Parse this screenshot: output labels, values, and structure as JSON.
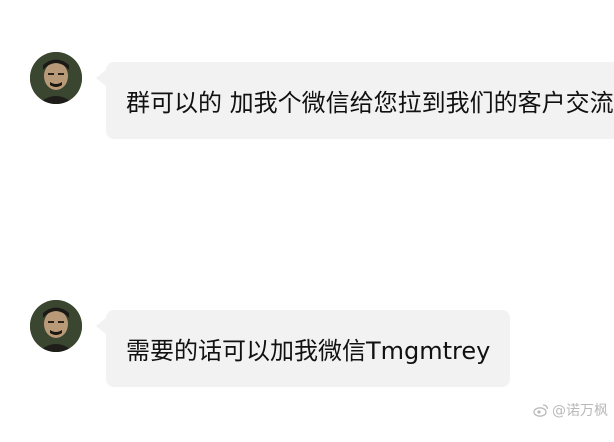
{
  "messages": [
    {
      "text": "群可以的 加我个微信给您拉到我们的客户交流群"
    },
    {
      "text": "需要的话可以加我微信Tmgmtrey"
    }
  ],
  "watermark": {
    "text": "@诺万枫",
    "icon": "weibo-icon"
  }
}
